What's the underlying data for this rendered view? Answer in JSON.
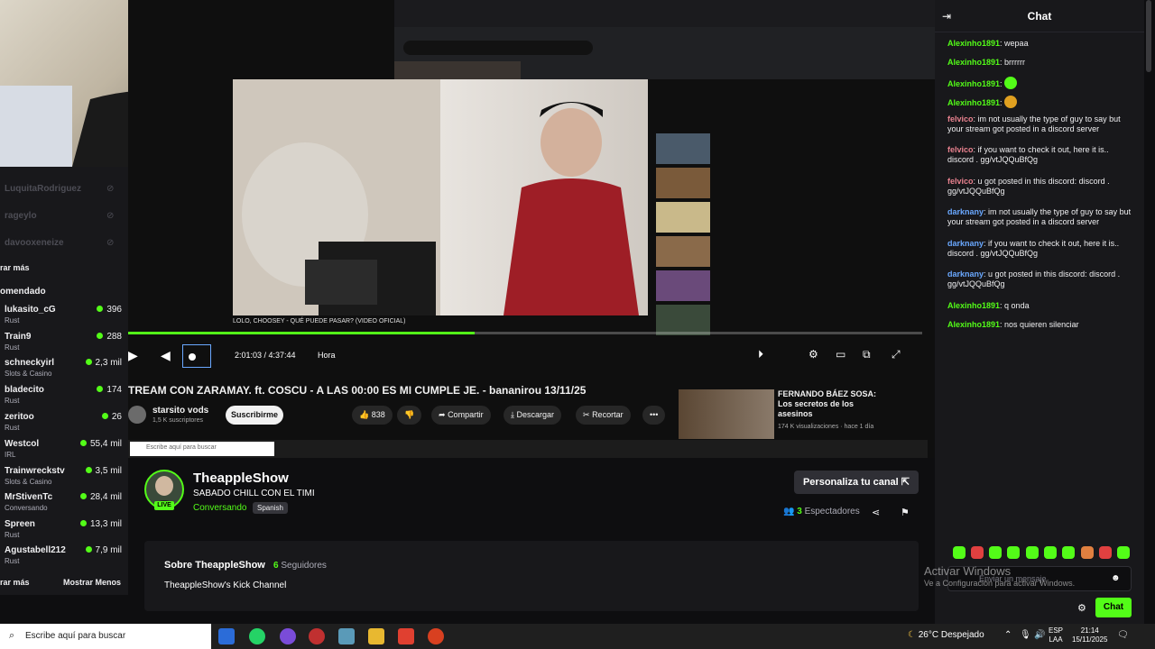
{
  "colors": {
    "kick_green": "#53fc18",
    "chat_user_red": "#e9828f",
    "chat_user_blue": "#6aa8ff",
    "chat_user_green": "#53fc18"
  },
  "sidebar": {
    "faded_channels": [
      "LuquitaRodriguez",
      "rageylo",
      "davooxeneize"
    ],
    "ver_mas": "rar más",
    "section_title": "omendado",
    "channels": [
      {
        "name": "lukasito_cG",
        "category": "Rust",
        "viewers": "396"
      },
      {
        "name": "Train9",
        "category": "Rust",
        "viewers": "288"
      },
      {
        "name": "schneckyirl",
        "category": "Slots & Casino",
        "viewers": "2,3 mil"
      },
      {
        "name": "bladecito",
        "category": "Rust",
        "viewers": "174"
      },
      {
        "name": "zeritoo",
        "category": "Rust",
        "viewers": "26"
      },
      {
        "name": "Westcol",
        "category": "IRL",
        "viewers": "55,4 mil"
      },
      {
        "name": "Trainwreckstv",
        "category": "Slots & Casino",
        "viewers": "3,5 mil"
      },
      {
        "name": "MrStivenTc",
        "category": "Conversando",
        "viewers": "28,4 mil"
      },
      {
        "name": "Spreen",
        "category": "Rust",
        "viewers": "13,3 mil"
      },
      {
        "name": "Agustabell212",
        "category": "Rust",
        "viewers": "7,9 mil"
      }
    ],
    "mostrar_mas": "rar más",
    "mostrar_menos": "Mostrar Menos"
  },
  "capture": {
    "yt_video_title": "LOLO, CHOOSEY - QUÉ PUEDE PASAR? (VIDEO OFICIAL)",
    "player_time": "2:01:03 / 4:37:44",
    "player_hora": "Hora",
    "progress": 0.436,
    "vod_title": "TREAM CON ZARAMAY. ft. COSCU - A LAS 00:00 ES MI CUMPLE JE. - bananirou 13/11/25",
    "vod_channel": "starsito vods",
    "vod_subs": "1,5 K suscriptores",
    "subscribe": "Suscribirme",
    "likes": "838",
    "share": "Compartir",
    "download": "Descargar",
    "clip": "Recortar",
    "rec_title": "FERNANDO BÁEZ SOSA: Los secretos de los asesinos",
    "rec_meta": "174 K visualizaciones · hace 1 día",
    "inner_search": "Escribe aquí para buscar"
  },
  "stream": {
    "channel_name": "TheappleShow",
    "title": "SABADO CHILL CON EL TIMI",
    "category": "Conversando",
    "language": "Spanish",
    "live_badge": "LIVE",
    "customize": "Personaliza tu canal",
    "viewers_count": "3",
    "viewers_label": "Espectadores"
  },
  "about": {
    "title": "Sobre TheappleShow",
    "followers_count": "6",
    "followers_label": "Seguidores",
    "description": "TheappleShow's Kick Channel"
  },
  "chat": {
    "title": "Chat",
    "messages": [
      {
        "user": "Alexinho1891",
        "text": "wepaa",
        "color": "#53fc18"
      },
      {
        "user": "Alexinho1891",
        "text": "brrrrrr",
        "color": "#53fc18"
      },
      {
        "user": "Alexinho1891",
        "text": "",
        "color": "#53fc18"
      },
      {
        "user": "Alexinho1891",
        "text": "",
        "color": "#53fc18"
      },
      {
        "user": "felvico",
        "text": "im not usually the type of guy to say but your stream got posted in a discord server",
        "color": "#e9828f"
      },
      {
        "user": "felvico",
        "text": "if you want to check it out, here it is.. discord . gg/vtJQQuBfQg",
        "color": "#e9828f"
      },
      {
        "user": "felvico",
        "text": "u got posted in this discord: discord . gg/vtJQQuBfQg",
        "color": "#e9828f"
      },
      {
        "user": "darknany",
        "text": "im not usually the type of guy to say but your stream got posted in a discord server",
        "color": "#6aa8ff"
      },
      {
        "user": "darknany",
        "text": "if you want to check it out, here it is.. discord . gg/vtJQQuBfQg",
        "color": "#6aa8ff"
      },
      {
        "user": "darknany",
        "text": "u got posted in this discord: discord . gg/vtJQQuBfQg",
        "color": "#6aa8ff"
      },
      {
        "user": "Alexinho1891",
        "text": "q onda",
        "color": "#53fc18"
      },
      {
        "user": "Alexinho1891",
        "text": "nos quieren silenciar",
        "color": "#53fc18"
      }
    ],
    "input_placeholder": "Enviar un mensaje",
    "send": "Chat"
  },
  "watermark": {
    "line1": "Activar Windows",
    "line2": "Ve a Configuración para activar Windows."
  },
  "taskbar": {
    "search": "Escribe aquí para buscar",
    "weather": "26°C  Despejado",
    "lang1": "ESP",
    "lang2": "LAA",
    "time": "21:14",
    "date": "15/11/2025"
  }
}
